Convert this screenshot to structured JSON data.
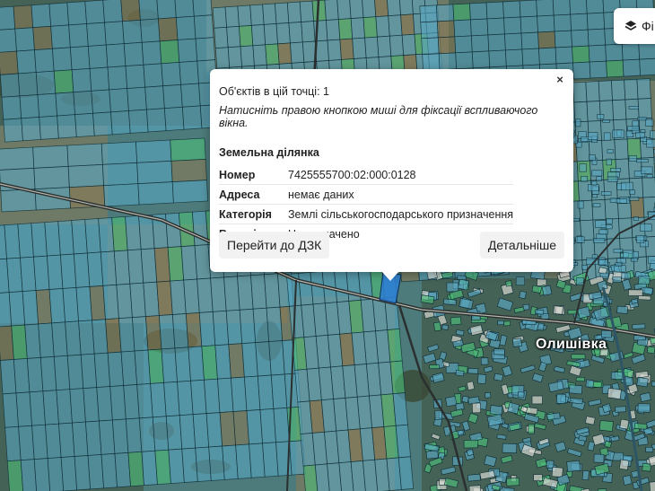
{
  "map": {
    "place_label": "Олишівка",
    "colors": {
      "imagery_base": "#4d7a7a",
      "parcel_fill": "#5aa7c2",
      "parcel_outline": "#0d2a33",
      "highlight_fill": "#2b7fd4",
      "green_parcel": "#4fbf7a",
      "field_brown": "#8a7a55",
      "forest_dark": "#3f4f3a"
    }
  },
  "layers_control": {
    "icon": "layers-icon",
    "label": "Фі"
  },
  "popup": {
    "close_label": "×",
    "count_line": "Об'єктів в цій точці: 1",
    "hint": "Натисніть правою кнопкою миші для фіксації вспливаючого вікна.",
    "section_title": "Земельна ділянка",
    "rows": [
      {
        "key": "Номер",
        "value": "7425555700:02:000:0128"
      },
      {
        "key": "Адреса",
        "value": "немає даних"
      },
      {
        "key": "Категорія",
        "value": "Землі сільськогосподарського призначення"
      },
      {
        "key": "Власність",
        "value": "Не визначено"
      }
    ],
    "goto_button": "Перейти до ДЗК",
    "details_button": "Детальніше"
  }
}
